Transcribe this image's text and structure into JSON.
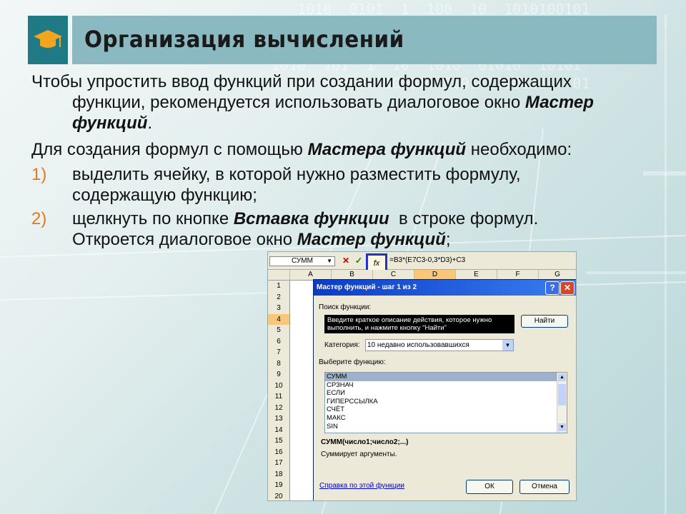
{
  "title": "Организация вычислений",
  "paragraphs": {
    "p1_a": "Чтобы упростить ввод функций при создании формул, содержащих",
    "p1_b": "функции, рекомендуется использовать диалоговое окно ",
    "p1_bi1": "Мастер",
    "p1_bi2": "функций",
    "p1_end": ".",
    "p2_a": "Для создания формул с помощью ",
    "p2_bi": "Мастера функций",
    "p2_b": " необходимо:"
  },
  "steps": [
    {
      "num": "1)",
      "line1": "выделить ячейку, в которой нужно разместить формулу,",
      "line2": "содержащую функцию;"
    },
    {
      "num": "2)",
      "line1_a": "щелкнуть по кнопке ",
      "line1_bi": "Вставка функции",
      "line1_b": "  в строке формул.",
      "line2_a": "Откроется диалоговое окно ",
      "line2_bi": "Мастер функций",
      "line2_b": ";"
    }
  ],
  "excel": {
    "name_box": "СУММ",
    "cancel_symbol": "✕",
    "enter_symbol": "✓",
    "fx_label": "fx",
    "formula": "=B3*(E7C3-0,3*D3)+C3",
    "columns": [
      "A",
      "B",
      "C",
      "D",
      "E",
      "F",
      "G"
    ],
    "rows": [
      "1",
      "2",
      "3",
      "4",
      "5",
      "6",
      "7",
      "8",
      "9",
      "10",
      "11",
      "12",
      "13",
      "14",
      "15",
      "16",
      "17",
      "18",
      "19",
      "20"
    ],
    "dialog": {
      "title": "Мастер функций - шаг 1 из 2",
      "help_symbol": "?",
      "close_symbol": "✕",
      "search_label": "Поиск функции:",
      "search_text_1": "Введите краткое описание действия, которое нужно",
      "search_text_2": "выполнить, и нажмите кнопку \"Найти\"",
      "find_button": "Найти",
      "category_label": "Категория:",
      "category_value": "10 недавно использовавшихся",
      "choose_label": "Выберите функцию:",
      "functions": [
        "СУММ",
        "СРЗНАЧ",
        "ЕСЛИ",
        "ГИПЕРССЫЛКА",
        "СЧЁТ",
        "МАКС",
        "SIN"
      ],
      "signature": "СУММ(число1;число2;...)",
      "description": "Суммирует аргументы.",
      "help_link": "Справка по этой функции",
      "ok_button": "ОК",
      "cancel_button": "Отмена"
    }
  }
}
